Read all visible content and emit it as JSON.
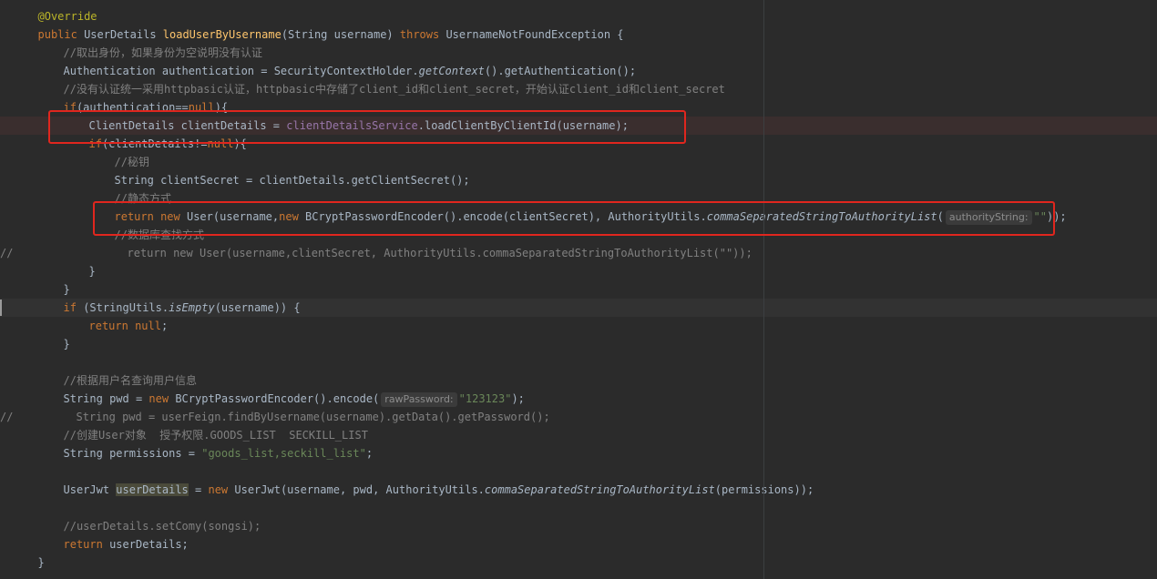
{
  "editor": {
    "lines": [
      {
        "indent": 2,
        "tokens": [
          [
            "ann",
            "@Override"
          ]
        ]
      },
      {
        "indent": 2,
        "tokens": [
          [
            "kw",
            "public "
          ],
          [
            "plain",
            "UserDetails "
          ],
          [
            "fn",
            "loadUserByUsername"
          ],
          [
            "plain",
            "(String username) "
          ],
          [
            "kw",
            "throws "
          ],
          [
            "plain",
            "UsernameNotFoundException {"
          ]
        ]
      },
      {
        "indent": 4,
        "tokens": [
          [
            "cmt",
            "//取出身份，如果身份为空说明没有认证"
          ]
        ]
      },
      {
        "indent": 4,
        "tokens": [
          [
            "plain",
            "Authentication authentication = SecurityContextHolder."
          ],
          [
            "it",
            "getContext"
          ],
          [
            "plain",
            "().getAuthentication();"
          ]
        ]
      },
      {
        "indent": 4,
        "tokens": [
          [
            "cmt",
            "//没有认证统一采用httpbasic认证，httpbasic中存储了client_id和client_secret，开始认证client_id和client_secret"
          ]
        ]
      },
      {
        "indent": 4,
        "tokens": [
          [
            "kw",
            "if"
          ],
          [
            "plain",
            "(authentication=="
          ],
          [
            "kw",
            "null"
          ],
          [
            "plain",
            "){"
          ]
        ]
      },
      {
        "indent": 6,
        "tokens": [
          [
            "plain",
            "ClientDetails clientDetails = "
          ],
          [
            "field",
            "clientDetailsService"
          ],
          [
            "plain",
            ".loadClientByClientId(username);"
          ]
        ]
      },
      {
        "indent": 6,
        "tokens": [
          [
            "kw",
            "if"
          ],
          [
            "plain",
            "(clientDetails!="
          ],
          [
            "kw",
            "null"
          ],
          [
            "plain",
            "){"
          ]
        ]
      },
      {
        "indent": 8,
        "tokens": [
          [
            "cmt",
            "//秘钥"
          ]
        ]
      },
      {
        "indent": 8,
        "tokens": [
          [
            "plain",
            "String clientSecret = clientDetails.getClientSecret();"
          ]
        ]
      },
      {
        "indent": 8,
        "tokens": [
          [
            "cmt",
            "//静态方式"
          ]
        ]
      },
      {
        "indent": 8,
        "tokens": [
          [
            "kw",
            "return new "
          ],
          [
            "plain",
            "User(username,"
          ],
          [
            "kw",
            "new "
          ],
          [
            "plain",
            "BCryptPasswordEncoder().encode(clientSecret), AuthorityUtils."
          ],
          [
            "it",
            "commaSeparatedStringToAuthorityList"
          ],
          [
            "plain",
            "("
          ],
          [
            "hint",
            "authorityString:"
          ],
          [
            "str",
            "\"\""
          ],
          [
            "plain",
            "));"
          ]
        ]
      },
      {
        "indent": 8,
        "tokens": [
          [
            "cmt",
            "//数据库查找方式"
          ]
        ]
      },
      {
        "indent": 9,
        "slash": "//",
        "tokens": [
          [
            "cmt",
            "return new User(username,clientSecret, AuthorityUtils.commaSeparatedStringToAuthorityList(\"\"));"
          ]
        ]
      },
      {
        "indent": 6,
        "tokens": [
          [
            "plain",
            "}"
          ]
        ]
      },
      {
        "indent": 4,
        "tokens": [
          [
            "plain",
            "}"
          ]
        ]
      },
      {
        "indent": 4,
        "tokens": [
          [
            "kw",
            "if "
          ],
          [
            "plain",
            "(StringUtils."
          ],
          [
            "it",
            "isEmpty"
          ],
          [
            "plain",
            "(username)) {"
          ]
        ]
      },
      {
        "indent": 6,
        "tokens": [
          [
            "kw",
            "return null"
          ],
          [
            "plain",
            ";"
          ]
        ]
      },
      {
        "indent": 4,
        "tokens": [
          [
            "plain",
            "}"
          ]
        ]
      },
      {
        "indent": 0,
        "tokens": []
      },
      {
        "indent": 4,
        "tokens": [
          [
            "cmt",
            "//根据用户名查询用户信息"
          ]
        ]
      },
      {
        "indent": 4,
        "tokens": [
          [
            "plain",
            "String pwd = "
          ],
          [
            "kw",
            "new "
          ],
          [
            "plain",
            "BCryptPasswordEncoder().encode("
          ],
          [
            "hint",
            "rawPassword:"
          ],
          [
            "str",
            "\"123123\""
          ],
          [
            "plain",
            ");"
          ]
        ]
      },
      {
        "indent": 5,
        "slash": "//",
        "tokens": [
          [
            "cmt",
            "String pwd = userFeign.findByUsername(username).getData().getPassword();"
          ]
        ]
      },
      {
        "indent": 4,
        "tokens": [
          [
            "cmt",
            "//创建User对象  授予权限.GOODS_LIST  SECKILL_LIST"
          ]
        ]
      },
      {
        "indent": 4,
        "tokens": [
          [
            "plain",
            "String permissions = "
          ],
          [
            "str",
            "\"goods_list,seckill_list\""
          ],
          [
            "plain",
            ";"
          ]
        ]
      },
      {
        "indent": 0,
        "tokens": []
      },
      {
        "indent": 4,
        "tokens": [
          [
            "plain",
            "UserJwt "
          ],
          [
            "varhl",
            "userDetails"
          ],
          [
            "plain",
            " = "
          ],
          [
            "kw",
            "new "
          ],
          [
            "plain",
            "UserJwt(username, pwd, AuthorityUtils."
          ],
          [
            "it",
            "commaSeparatedStringToAuthorityList"
          ],
          [
            "plain",
            "(permissions));"
          ]
        ]
      },
      {
        "indent": 0,
        "tokens": []
      },
      {
        "indent": 4,
        "tokens": [
          [
            "cmt",
            "//userDetails.setComy(songsi);"
          ]
        ]
      },
      {
        "indent": 4,
        "tokens": [
          [
            "kw",
            "return "
          ],
          [
            "plain",
            "userDetails;"
          ]
        ]
      },
      {
        "indent": 2,
        "tokens": [
          [
            "plain",
            "}"
          ]
        ]
      }
    ]
  },
  "colors": {
    "background": "#2b2b2b",
    "keyword": "#cc7832",
    "annotation": "#bbb529",
    "method": "#ffc66d",
    "comment": "#808080",
    "string": "#6a8759",
    "field": "#9876aa",
    "highlight_box": "#e0261e"
  }
}
